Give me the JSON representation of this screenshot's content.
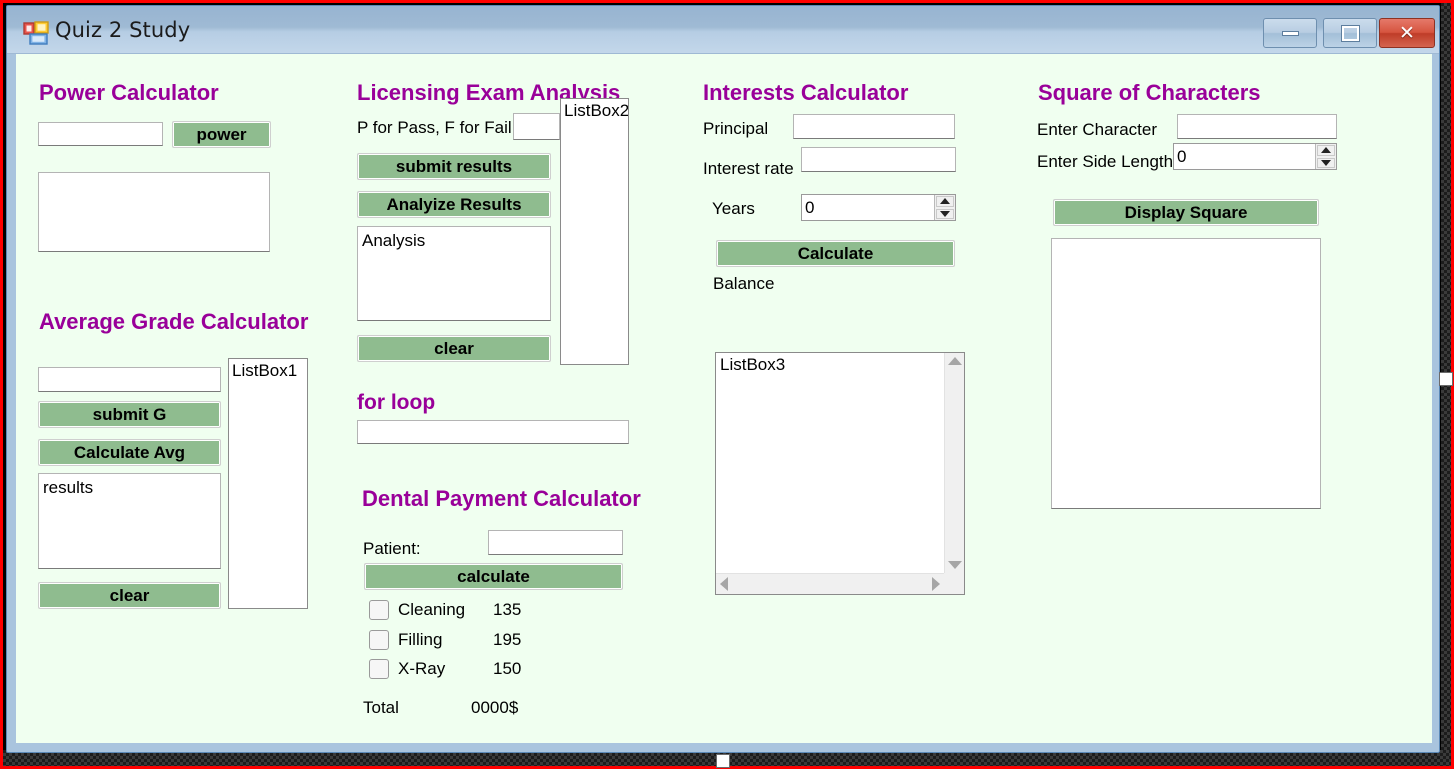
{
  "window": {
    "title": "Quiz 2 Study",
    "icon": "app-window-icon",
    "buttons": {
      "minimize": "minimize-icon",
      "maximize": "maximize-icon",
      "close": "close-icon"
    }
  },
  "theme": {
    "accent_heading": "#990099",
    "button_green": "#8fbc8f",
    "client_bg": "#f0fff0",
    "titlebar_top": "#97b4d1",
    "titlebar_bottom": "#c3d7ea",
    "close_red": "#c63f28"
  },
  "power_calculator": {
    "title": "Power Calculator",
    "input_value": "",
    "power_button": "power",
    "output_value": ""
  },
  "average_grade_calculator": {
    "title": "Average Grade Calculator",
    "grade_input_value": "",
    "submit_button": "submit G",
    "calculate_button": "Calculate Avg",
    "results_text": "results",
    "clear_button": "clear",
    "listbox_label": "ListBox1"
  },
  "licensing_exam_analysis": {
    "title": "Licensing Exam Analysis",
    "prompt_label": "P for Pass, F for Fail",
    "entry_value": "",
    "submit_button": "submit results",
    "analyze_button": "Analyize Results",
    "analysis_text": "Analysis",
    "clear_button": "clear",
    "listbox_label": "ListBox2"
  },
  "for_loop": {
    "title": "for loop",
    "output_value": ""
  },
  "dental_payment_calculator": {
    "title": "Dental Payment Calculator",
    "patient_label": "Patient:",
    "patient_value": "",
    "calculate_button": "calculate",
    "services": [
      {
        "name": "Cleaning",
        "price": "135",
        "checked": false
      },
      {
        "name": "Filling",
        "price": "195",
        "checked": false
      },
      {
        "name": "X-Ray",
        "price": "150",
        "checked": false
      }
    ],
    "total_label": "Total",
    "total_value": "0000$"
  },
  "interests_calculator": {
    "title": "Interests Calculator",
    "principal_label": "Principal",
    "principal_value": "",
    "interest_rate_label": "Interest rate",
    "interest_rate_value": "",
    "years_label": "Years",
    "years_value": "0",
    "calculate_button": "Calculate",
    "balance_label": "Balance",
    "listbox_label": "ListBox3"
  },
  "square_of_characters": {
    "title": "Square of Characters",
    "character_label": "Enter Character",
    "character_value": "",
    "side_length_label": "Enter Side Length",
    "side_length_value": "0",
    "display_button": "Display Square",
    "output_value": ""
  }
}
